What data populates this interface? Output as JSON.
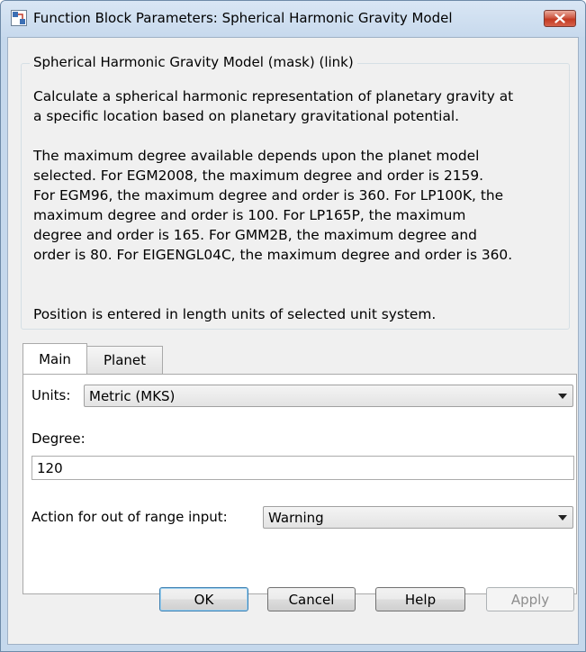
{
  "window": {
    "title": "Function Block Parameters: Spherical Harmonic Gravity Model"
  },
  "group": {
    "title": "Spherical Harmonic Gravity Model (mask) (link)",
    "paragraphs": [
      [
        "Calculate a spherical harmonic representation of planetary gravity at",
        "a specific location based on planetary gravitational potential."
      ],
      [
        "The maximum degree available depends upon the planet model",
        "selected.  For EGM2008, the maximum degree and order is 2159.",
        "For EGM96, the maximum degree and order is 360.  For LP100K, the",
        "maximum degree and order is 100.  For LP165P, the maximum",
        "degree and order is 165.  For GMM2B, the maximum degree and",
        "order is 80.  For EIGENGL04C, the maximum degree and order is 360."
      ],
      [
        "Position is entered in length units of selected unit system."
      ]
    ]
  },
  "tabs": [
    {
      "label": "Main",
      "active": true
    },
    {
      "label": "Planet",
      "active": false
    }
  ],
  "main": {
    "units_label": "Units:",
    "units_value": "Metric (MKS)",
    "degree_label": "Degree:",
    "degree_value": "120",
    "action_label": "Action for out of range input:",
    "action_value": "Warning"
  },
  "buttons": {
    "ok": "OK",
    "cancel": "Cancel",
    "help": "Help",
    "apply": "Apply"
  }
}
